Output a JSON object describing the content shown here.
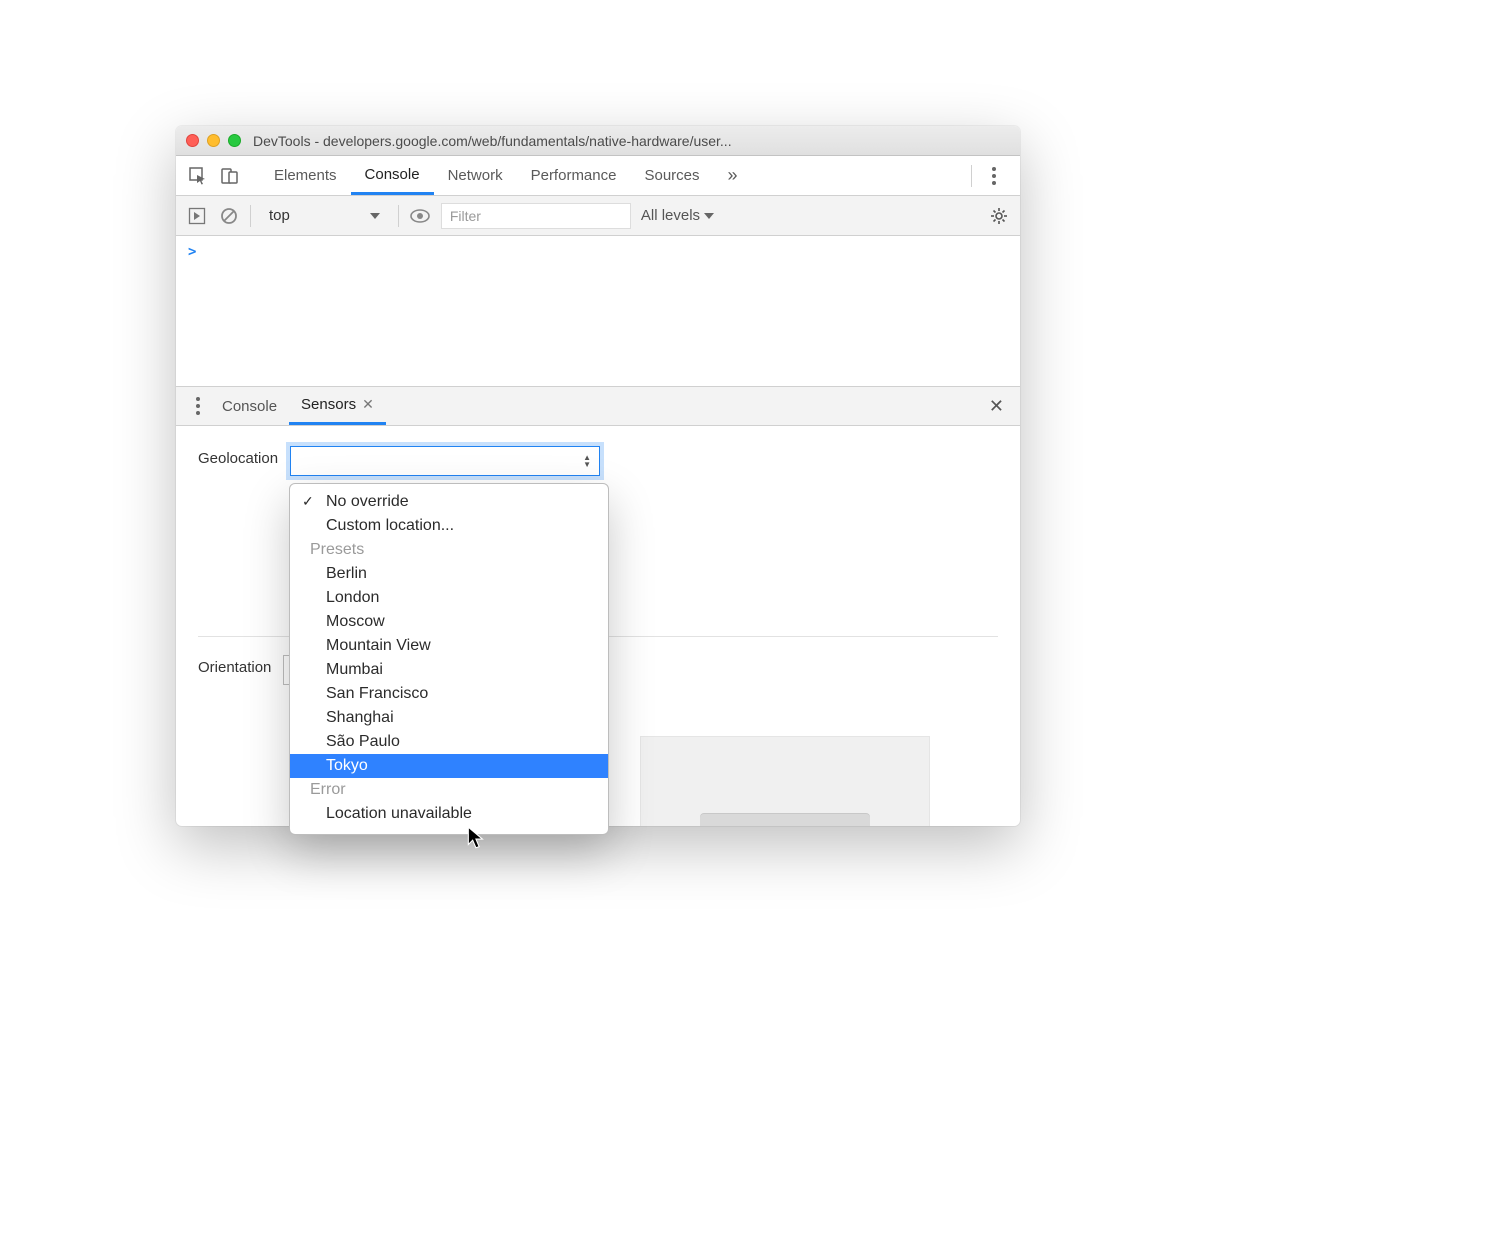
{
  "window": {
    "title": "DevTools - developers.google.com/web/fundamentals/native-hardware/user..."
  },
  "main_tabs": {
    "items": [
      "Elements",
      "Console",
      "Network",
      "Performance",
      "Sources"
    ],
    "active_index": 1,
    "overflow_glyph": "»"
  },
  "console_toolbar": {
    "context": "top",
    "filter_placeholder": "Filter",
    "levels_label": "All levels"
  },
  "console_prompt": ">",
  "drawer_tabs": {
    "items": [
      "Console",
      "Sensors"
    ],
    "active_index": 1
  },
  "sensors": {
    "geolocation_label": "Geolocation",
    "orientation_label": "Orientation"
  },
  "geo_dropdown": {
    "top_items": [
      "No override",
      "Custom location..."
    ],
    "checked_index": 0,
    "presets_label": "Presets",
    "presets": [
      "Berlin",
      "London",
      "Moscow",
      "Mountain View",
      "Mumbai",
      "San Francisco",
      "Shanghai",
      "São Paulo",
      "Tokyo"
    ],
    "highlight_preset_index": 8,
    "error_label": "Error",
    "error_items": [
      "Location unavailable"
    ]
  }
}
